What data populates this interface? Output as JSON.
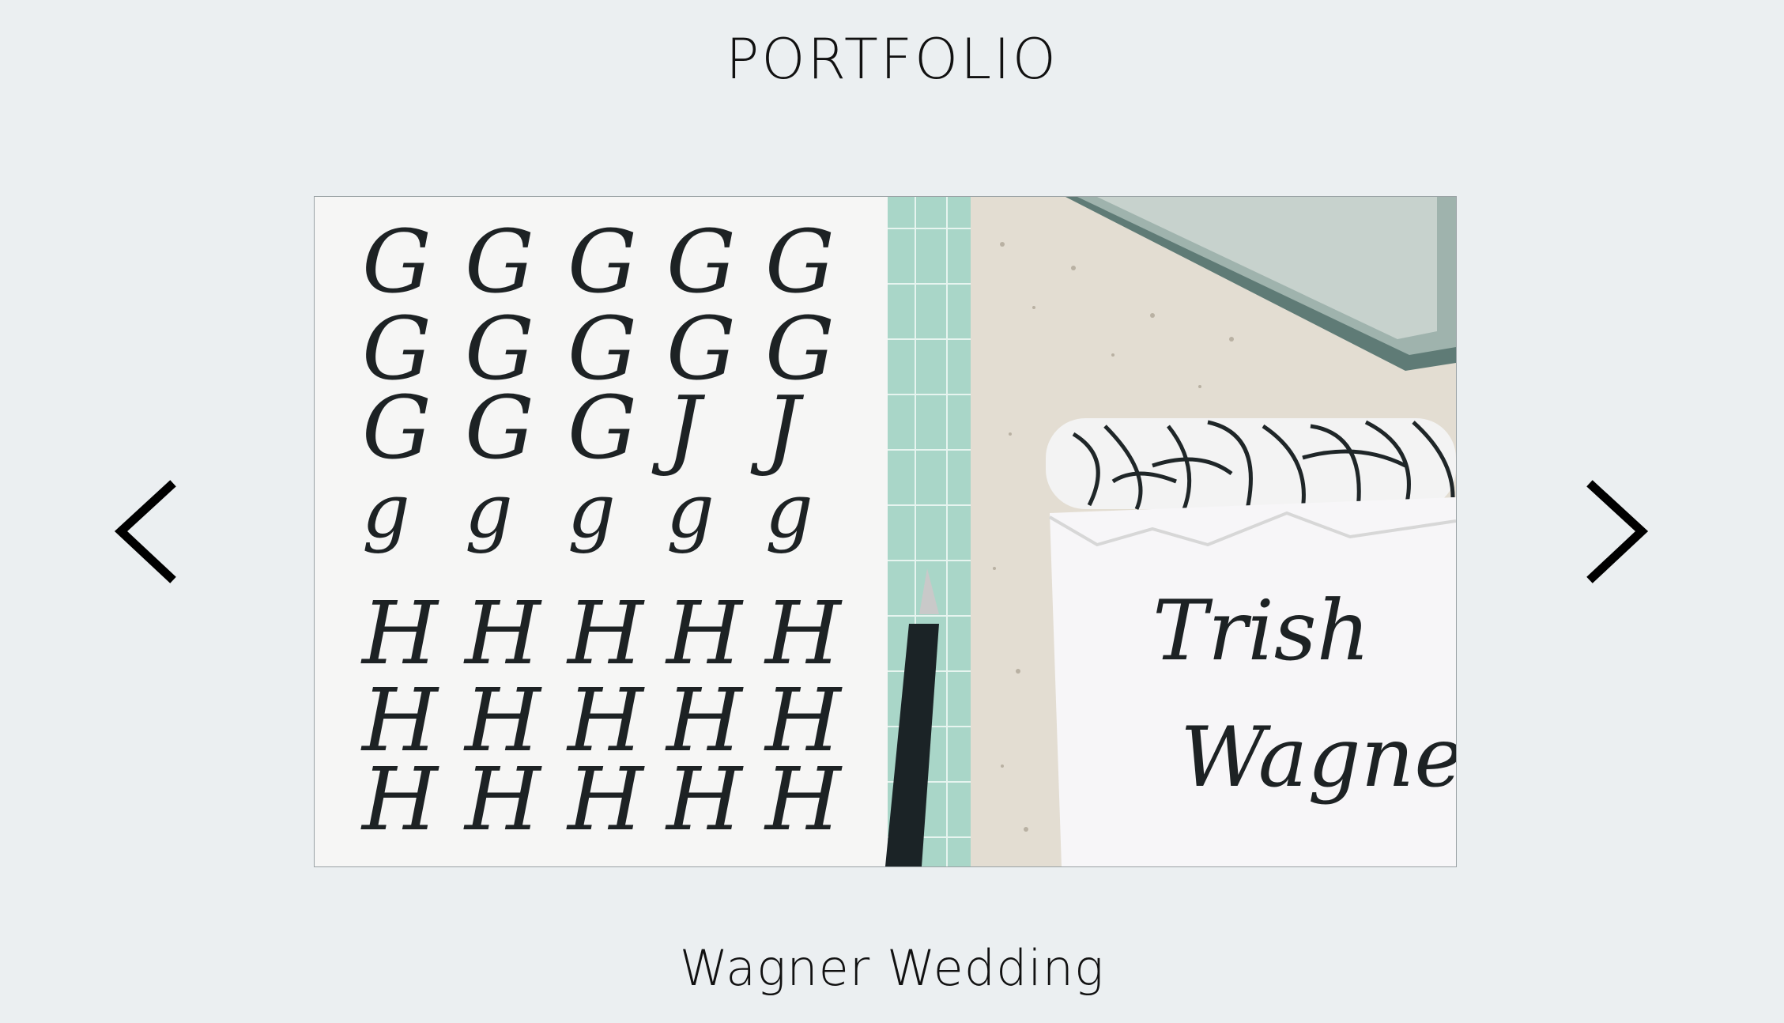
{
  "page": {
    "title": "PORTFOLIO"
  },
  "carousel": {
    "prev_icon": "chevron-left-icon",
    "next_icon": "chevron-right-icon",
    "caption": "Wagner Wedding",
    "image": {
      "description_labels": {
        "card_line_1": "Trish",
        "card_line_2": "Wagner"
      },
      "practice_rows": [
        [
          "G",
          "G",
          "G",
          "G",
          "G"
        ],
        [
          "G",
          "G",
          "G",
          "G",
          "G"
        ],
        [
          "G",
          "G",
          "G",
          "J",
          "J"
        ],
        [
          "g",
          "g",
          "g",
          "g",
          "g"
        ],
        [
          "H",
          "H",
          "H",
          "H",
          "H"
        ],
        [
          "H",
          "H",
          "H",
          "H",
          "H"
        ],
        [
          "H",
          "H",
          "H",
          "H",
          "H"
        ]
      ]
    }
  },
  "colors": {
    "background": "#ebeff1",
    "text": "#111111",
    "mat": "#a7d4c7"
  }
}
